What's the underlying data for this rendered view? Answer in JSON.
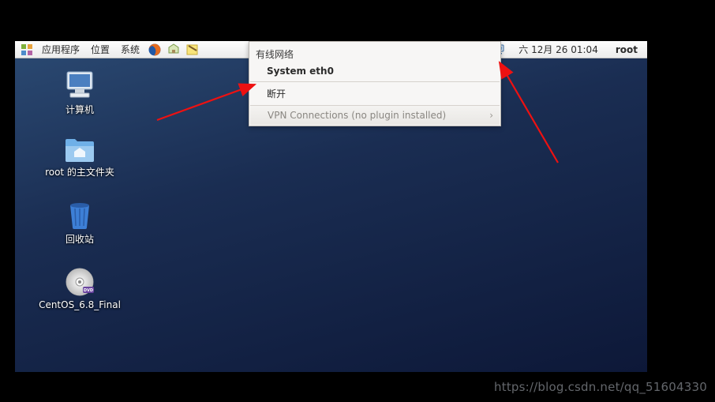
{
  "taskbar": {
    "menus": {
      "applications": "应用程序",
      "places": "位置",
      "system": "系统"
    },
    "clock": "六 12月 26 01:04",
    "user": "root"
  },
  "desktop": {
    "computer": "计算机",
    "home": "root 的主文件夹",
    "trash": "回收站",
    "disc": "CentOS_6.8_Final"
  },
  "network_menu": {
    "wired_header": "有线网络",
    "wired_item": "System eth0",
    "disconnect": "断开",
    "vpn": "VPN Connections (no plugin installed)"
  },
  "watermark": "https://blog.csdn.net/qq_51604330"
}
